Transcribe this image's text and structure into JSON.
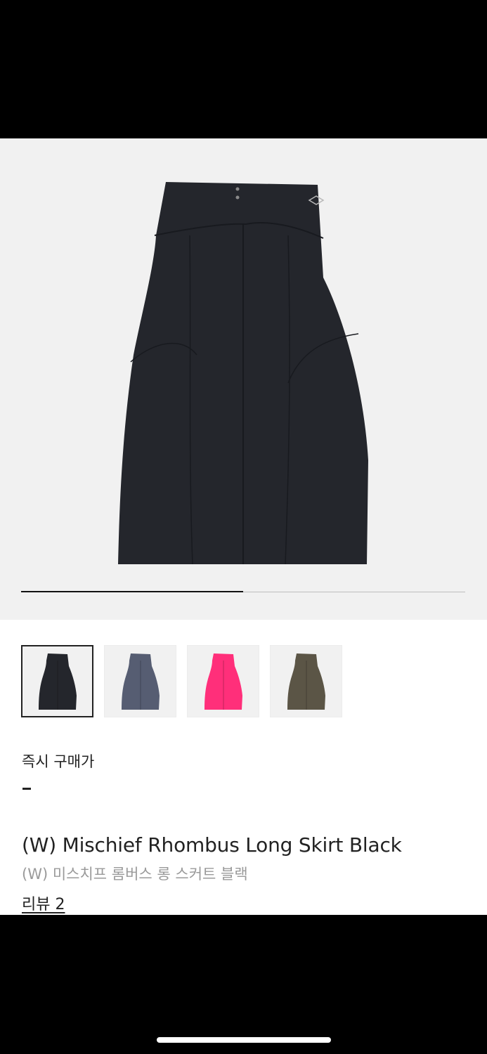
{
  "gallery": {
    "current_slide": 1,
    "total_slides": 2,
    "progress_fraction": 0.5
  },
  "variants": [
    {
      "name": "black",
      "color": "#24262c",
      "selected": true
    },
    {
      "name": "gray",
      "color": "#565d72",
      "selected": false
    },
    {
      "name": "pink",
      "color": "#ff2f7a",
      "selected": false
    },
    {
      "name": "khaki",
      "color": "#5b5546",
      "selected": false
    }
  ],
  "price": {
    "label": "즉시 구매가",
    "value": "-"
  },
  "product": {
    "name_en": "(W) Mischief Rhombus Long Skirt Black",
    "name_ko": "(W) 미스치프 롬버스 롱 스커트 블랙"
  },
  "reviews": {
    "label": "리뷰 2"
  },
  "icons": {
    "main_image": "skirt-black-image"
  }
}
